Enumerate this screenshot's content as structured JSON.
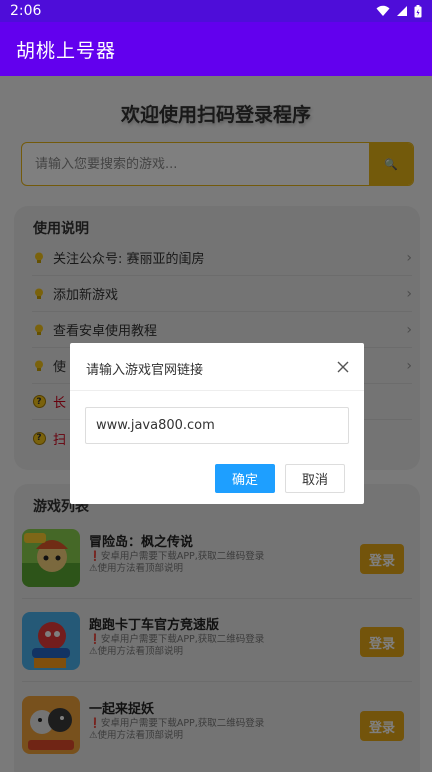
{
  "status_bar": {
    "time": "2:06"
  },
  "app": {
    "title": "胡桃上号器"
  },
  "page": {
    "welcome": "欢迎使用扫码登录程序",
    "search": {
      "placeholder": "请输入您要搜索的游戏...",
      "button_glyph": "🔍"
    }
  },
  "guide": {
    "title": "使用说明",
    "items": [
      {
        "label": "关注公众号: 赛丽亚的闺房",
        "icon": "lightbulb-icon"
      },
      {
        "label": "添加新游戏",
        "icon": "lightbulb-icon"
      },
      {
        "label": "查看安卓使用教程",
        "icon": "lightbulb-icon"
      },
      {
        "label": "使",
        "icon": "lightbulb-icon"
      },
      {
        "label": "长",
        "icon": "question-icon",
        "color": "#d0021b"
      },
      {
        "label": "扫",
        "icon": "question-icon",
        "color": "#d0021b"
      }
    ]
  },
  "games": {
    "title": "游戏列表",
    "login_label": "登录",
    "items": [
      {
        "name": "冒险岛：枫之传说",
        "desc1": "❗安卓用户需要下载APP,获取二维码登录",
        "desc2": "⚠使用方法看顶部说明"
      },
      {
        "name": "跑跑卡丁车官方竞速版",
        "desc1": "❗安卓用户需要下载APP,获取二维码登录",
        "desc2": "⚠使用方法看顶部说明"
      },
      {
        "name": "一起来捉妖",
        "desc1": "❗安卓用户需要下载APP,获取二维码登录",
        "desc2": "⚠使用方法看顶部说明"
      }
    ]
  },
  "dialog": {
    "title": "请输入游戏官网链接",
    "input_value": "www.java800.com",
    "ok": "确定",
    "cancel": "取消"
  },
  "colors": {
    "accent": "#6200ee",
    "gold": "#e6b417",
    "dialog_ok": "#1e9fff"
  }
}
